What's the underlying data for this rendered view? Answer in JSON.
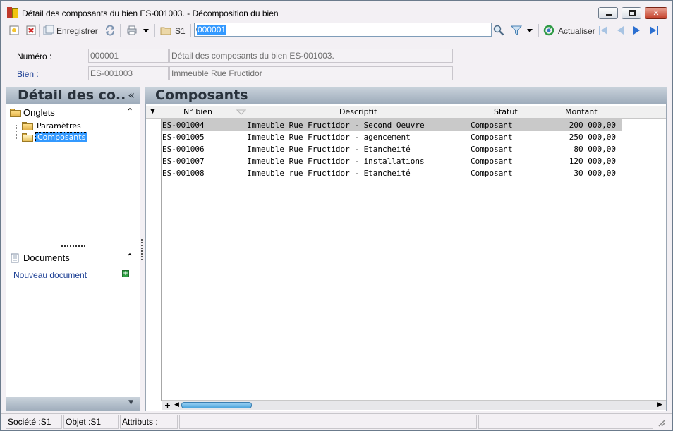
{
  "window": {
    "title": "Détail des composants du bien ES-001003. -  Décomposition du bien",
    "minimize_glyph": "",
    "maximize_glyph": "",
    "close_glyph": "✕"
  },
  "toolbar": {
    "save_label": "Enregistrer",
    "section_label": "S1",
    "search_value": "000001",
    "refresh_label": "Actualiser"
  },
  "form": {
    "numero_label": "Numéro :",
    "numero_value": "000001",
    "numero_desc": "Détail des composants du bien ES-001003.",
    "bien_label": "Bien :",
    "bien_value": "ES-001003",
    "bien_desc": "Immeuble Rue Fructidor",
    "bien_label_color": "#1c3f94"
  },
  "left_panel": {
    "title": "Détail des co..",
    "collapse_glyph": "«",
    "tabs_section": {
      "label": "Onglets",
      "items": [
        {
          "label": "Paramètres",
          "selected": false
        },
        {
          "label": "Composants",
          "selected": true
        }
      ]
    },
    "documents_section": {
      "label": "Documents",
      "new_document": "Nouveau document"
    }
  },
  "main": {
    "title": "Composants",
    "columns": [
      "N° bien",
      "Descriptif",
      "Statut",
      "Montant"
    ],
    "rows": [
      {
        "n_bien": "ES-001004",
        "descriptif": "Immeuble Rue Fructidor - Second Oeuvre",
        "statut": "Composant",
        "montant": "200 000,00",
        "selected": true
      },
      {
        "n_bien": "ES-001005",
        "descriptif": "Immeuble Rue Fructidor - agencement",
        "statut": "Composant",
        "montant": "250 000,00",
        "selected": false
      },
      {
        "n_bien": "ES-001006",
        "descriptif": "Immeuble Rue Fructidor - Etancheité",
        "statut": "Composant",
        "montant": "80 000,00",
        "selected": false
      },
      {
        "n_bien": "ES-001007",
        "descriptif": "Immeuble Rue Fructidor - installations",
        "statut": "Composant",
        "montant": "120 000,00",
        "selected": false
      },
      {
        "n_bien": "ES-001008",
        "descriptif": "Immeuble rue Fructidor - Etancheité",
        "statut": "Composant",
        "montant": "30 000,00",
        "selected": false
      }
    ]
  },
  "statusbar": {
    "societe": "Société :S1",
    "objet": "Objet :S1",
    "attributs": "Attributs :"
  },
  "colors": {
    "selection": "#3399ff",
    "panel_header": "#9eacbb",
    "row_selected": "#c9c9c9"
  }
}
